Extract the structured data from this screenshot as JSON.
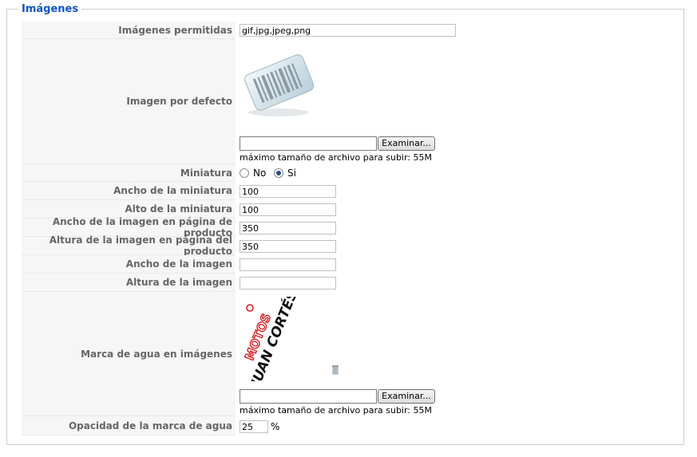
{
  "fieldset": {
    "legend": "Imágenes"
  },
  "allowed": {
    "label": "Imágenes permitidas",
    "value": "gif,jpg,jpeg,png"
  },
  "default_image": {
    "label": "Imagen por defecto",
    "browse_label": "Examinar...",
    "max_note": "máximo tamaño de archivo para subir: 55M"
  },
  "thumbnail": {
    "label": "Miniatura",
    "options": [
      "No",
      "Si"
    ],
    "selected": "Si"
  },
  "thumb_width": {
    "label": "Ancho de la miniatura",
    "value": "100"
  },
  "thumb_height": {
    "label": "Alto de la miniatura",
    "value": "100"
  },
  "product_width": {
    "label": "Ancho de la imagen en página de producto",
    "value": "350"
  },
  "product_height": {
    "label": "Altura de la imagen en página del producto",
    "value": "350"
  },
  "image_width": {
    "label": "Ancho de la imagen",
    "value": ""
  },
  "image_height": {
    "label": "Altura de la imagen",
    "value": ""
  },
  "watermark": {
    "label": "Marca de agua en imágenes",
    "logo_text_top": "MOTOS",
    "logo_text_main": "JUAN CORTÉS",
    "browse_label": "Examinar...",
    "max_note": "máximo tamaño de archivo para subir: 55M"
  },
  "opacity": {
    "label": "Opacidad de la marca de agua",
    "value": "25",
    "unit": "%"
  },
  "colors": {
    "legend": "#0b55c4",
    "label": "#666666",
    "label_bg": "#f6f6f6",
    "logo_red": "#d9141b"
  },
  "icons": [
    "barcode-icon",
    "trash-icon"
  ]
}
